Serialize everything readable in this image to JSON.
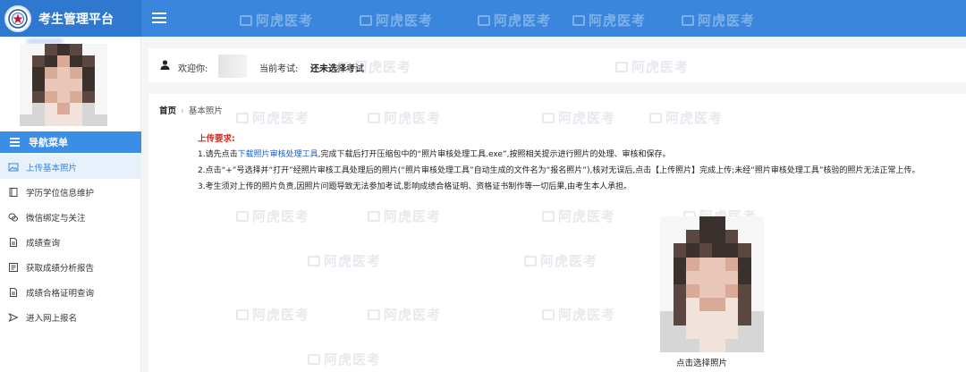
{
  "app": {
    "title": "考生管理平台",
    "header_color": "#3a86dc",
    "brand_color": "#2e78d0"
  },
  "header": {
    "menu_toggle_icon": "hamburger-icon",
    "watermark": "阿虎医考"
  },
  "sidebar": {
    "nav_title": "导航菜单",
    "items": [
      {
        "label": "上传基本照片",
        "icon": "image-icon",
        "active": true
      },
      {
        "label": "学历学位信息维护",
        "icon": "book-icon",
        "active": false
      },
      {
        "label": "微信绑定与关注",
        "icon": "link-icon",
        "active": false
      },
      {
        "label": "成绩查询",
        "icon": "document-icon",
        "active": false
      },
      {
        "label": "获取成绩分析报告",
        "icon": "report-icon",
        "active": false
      },
      {
        "label": "成绩合格证明查询",
        "icon": "document-icon",
        "active": false
      },
      {
        "label": "进入网上报名",
        "icon": "send-icon",
        "active": false
      }
    ]
  },
  "welcome": {
    "label": "欢迎你:",
    "current_exam_label": "当前考试:",
    "current_exam_value": "还未选择考试"
  },
  "breadcrumb": {
    "home": "首页",
    "current": "基本照片"
  },
  "upload": {
    "title": "上传要求:",
    "line1_prefix": "1.请先点击",
    "line1_link": "下载照片审核处理工具",
    "line1_suffix": ",完成下载后打开压缩包中的“照片审核处理工具.exe”,按照相关提示进行照片的处理、审核和保存。",
    "line2": "2.点击“+”号选择并“打开”经照片审核工具处理后的照片(“照片审核处理工具”自动生成的文件名为“报名照片”),核对无误后,点击【上传照片】完成上传;未经“照片审核处理工具”核验的照片无法正常上传。",
    "line3": "3.考生须对上传的照片负责,因照片问题导致无法参加考试,影响成绩合格证明、资格证书制作等一切后果,由考生本人承担。",
    "photo_caption": "点击选择照片"
  }
}
